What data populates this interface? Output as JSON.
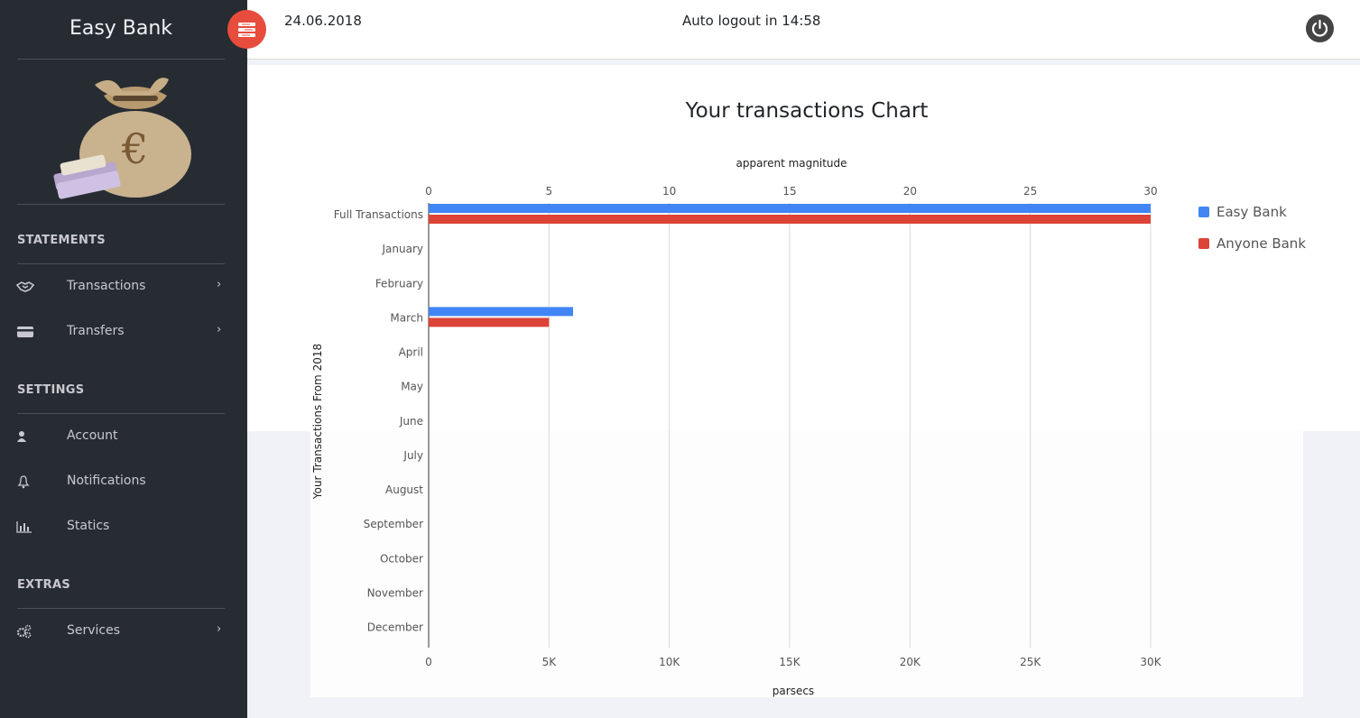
{
  "app": {
    "name": "Easy Bank"
  },
  "header": {
    "date": "24.06.2018",
    "logout": "Auto logout in 14:58"
  },
  "sidebar": {
    "sections": [
      {
        "title": "STATEMENTS",
        "items": [
          {
            "label": "Transactions",
            "icon": "handshake-icon",
            "chevron": "›"
          },
          {
            "label": "Transfers",
            "icon": "credit-card-icon",
            "chevron": "›"
          }
        ]
      },
      {
        "title": "SETTINGS",
        "items": [
          {
            "label": "Account",
            "icon": "user-icon"
          },
          {
            "label": "Notifications",
            "icon": "bell-icon"
          },
          {
            "label": "Statics",
            "icon": "bar-chart-icon"
          }
        ]
      },
      {
        "title": "EXTRAS",
        "items": [
          {
            "label": "Services",
            "icon": "gears-icon",
            "chevron": "›"
          }
        ]
      }
    ]
  },
  "colors": {
    "sidebar": "#272c33",
    "accent": "#e74c3c",
    "easy": "#4285f4",
    "anyone": "#db4437"
  },
  "chart_data": {
    "type": "bar",
    "orientation": "horizontal",
    "title": "Your transactions Chart",
    "top_axis_label": "apparent magnitude",
    "bottom_axis_label": "parsecs",
    "ylabel": "Your Transactions From 2018",
    "top_ticks": [
      "0",
      "5",
      "10",
      "15",
      "20",
      "25",
      "30"
    ],
    "bottom_ticks": [
      "0",
      "5K",
      "10K",
      "15K",
      "20K",
      "25K",
      "30K"
    ],
    "xlim": [
      0,
      30
    ],
    "categories": [
      "Full Transactions",
      "January",
      "February",
      "March",
      "April",
      "May",
      "June",
      "July",
      "August",
      "September",
      "October",
      "November",
      "December"
    ],
    "series": [
      {
        "name": "Easy Bank",
        "color": "#4285f4",
        "values": [
          30,
          0,
          0,
          6,
          0,
          0,
          0,
          0,
          0,
          0,
          0,
          0,
          0
        ]
      },
      {
        "name": "Anyone Bank",
        "color": "#db4437",
        "values": [
          30,
          0,
          0,
          5,
          0,
          0,
          0,
          0,
          0,
          0,
          0,
          0,
          0
        ]
      }
    ],
    "legend": "right",
    "grid": true
  }
}
